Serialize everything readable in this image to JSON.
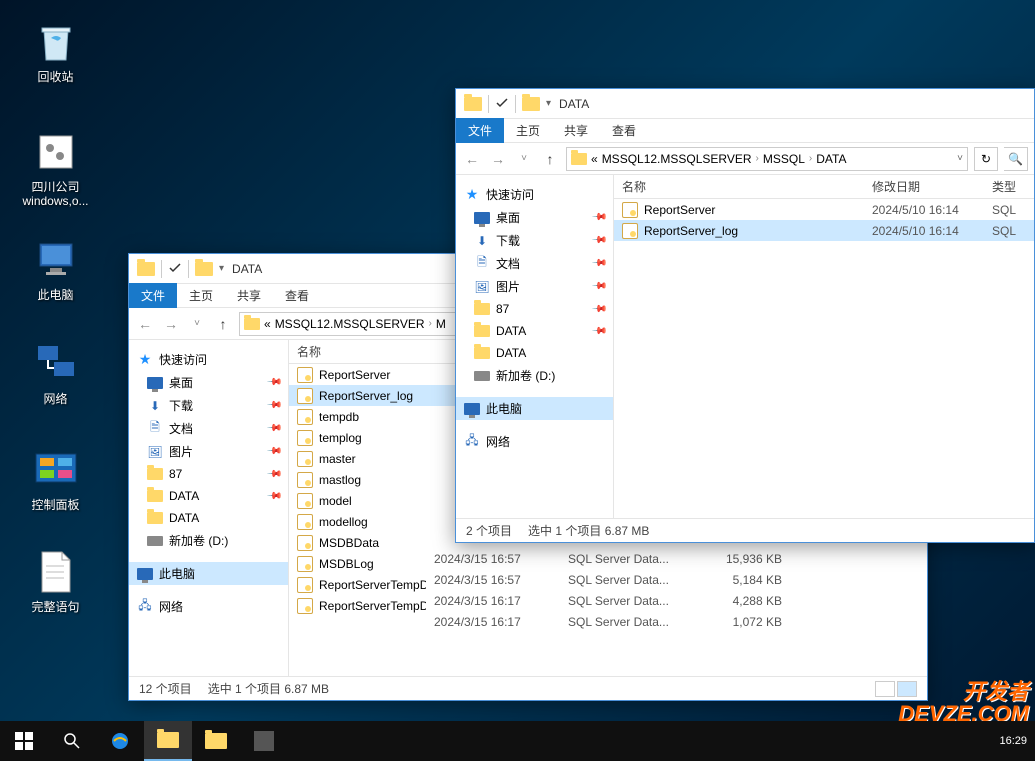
{
  "desktop": {
    "recycle_bin": "回收站",
    "sichuan": "四川公司\nwindows,o...",
    "this_pc": "此电脑",
    "network": "网络",
    "control_panel": "控制面板",
    "full_sentence": "完整语句"
  },
  "win1": {
    "title": "DATA",
    "tabs": {
      "file": "文件",
      "home": "主页",
      "share": "共享",
      "view": "查看"
    },
    "path": {
      "prefix": "«",
      "p1": "MSSQL12.MSSQLSERVER",
      "p2": "M"
    },
    "nav": {
      "quick": "快速访问",
      "desktop": "桌面",
      "downloads": "下载",
      "documents": "文档",
      "pictures": "图片",
      "n87": "87",
      "data1": "DATA",
      "data2": "DATA",
      "drive": "新加卷 (D:)",
      "thispc": "此电脑",
      "network": "网络"
    },
    "cols": {
      "name": "名称"
    },
    "files": [
      {
        "name": "ReportServer"
      },
      {
        "name": "ReportServer_log",
        "selected": true
      },
      {
        "name": "tempdb"
      },
      {
        "name": "templog"
      },
      {
        "name": "master"
      },
      {
        "name": "mastlog"
      },
      {
        "name": "model"
      },
      {
        "name": "modellog"
      },
      {
        "name": "MSDBData"
      },
      {
        "name": "MSDBLog"
      },
      {
        "name": "ReportServerTempDB"
      },
      {
        "name": "ReportServerTempDB_log"
      }
    ],
    "lower_rows": [
      {
        "date": "2024/3/15 16:57",
        "type": "SQL Server Data...",
        "size": "15,936 KB"
      },
      {
        "date": "2024/3/15 16:57",
        "type": "SQL Server Data...",
        "size": "5,184 KB"
      },
      {
        "date": "2024/3/15 16:17",
        "type": "SQL Server Data...",
        "size": "4,288 KB"
      },
      {
        "date": "2024/3/15 16:17",
        "type": "SQL Server Data...",
        "size": "1,072 KB"
      }
    ],
    "status": {
      "count": "12 个项目",
      "selection": "选中 1 个项目  6.87 MB"
    }
  },
  "win2": {
    "title": "DATA",
    "tabs": {
      "file": "文件",
      "home": "主页",
      "share": "共享",
      "view": "查看"
    },
    "path": {
      "prefix": "«",
      "p1": "MSSQL12.MSSQLSERVER",
      "p2": "MSSQL",
      "p3": "DATA"
    },
    "nav": {
      "quick": "快速访问",
      "desktop": "桌面",
      "downloads": "下载",
      "documents": "文档",
      "pictures": "图片",
      "n87": "87",
      "data1": "DATA",
      "data2": "DATA",
      "drive": "新加卷 (D:)",
      "thispc": "此电脑",
      "network": "网络"
    },
    "cols": {
      "name": "名称",
      "date": "修改日期",
      "type": "类型"
    },
    "files": [
      {
        "name": "ReportServer",
        "date": "2024/5/10 16:14",
        "type": "SQL"
      },
      {
        "name": "ReportServer_log",
        "date": "2024/5/10 16:14",
        "type": "SQL",
        "selected": true
      }
    ],
    "status": {
      "count": "2 个项目",
      "selection": "选中 1 个项目  6.87 MB"
    }
  },
  "tray": {
    "time": "16:29"
  },
  "watermark": {
    "l1": "开发者",
    "l2": "DEVZE.COM"
  }
}
